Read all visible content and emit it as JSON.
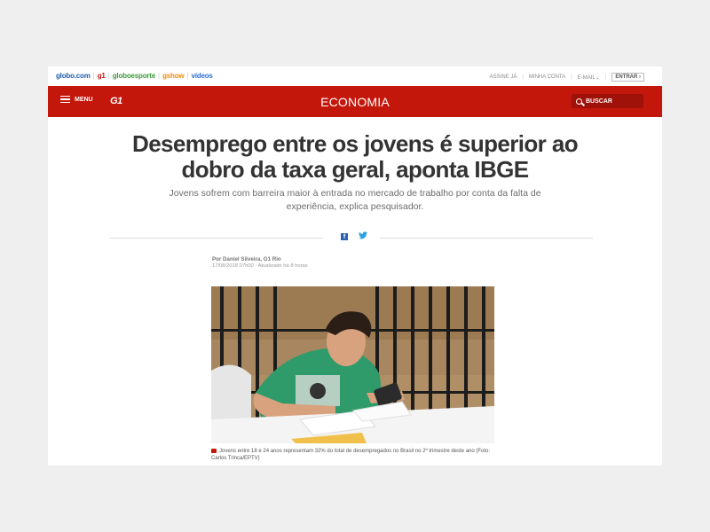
{
  "topbar": {
    "brands": [
      {
        "label": "globo.com",
        "color": "#1d5dad"
      },
      {
        "label": "g1",
        "color": "#c4170c"
      },
      {
        "label": "globoesporte",
        "color": "#3c9b3c"
      },
      {
        "label": "gshow",
        "color": "#f28c0f"
      },
      {
        "label": "vídeos",
        "color": "#2f6fd6"
      }
    ],
    "links": [
      "ASSINE JÁ",
      "MINHA CONTA",
      "E-MAIL"
    ],
    "email_chevron": "⌄",
    "enter_label": "ENTRAR",
    "enter_chevron": "›"
  },
  "header": {
    "menu_label": "MENU",
    "logo": "G1",
    "section": "ECONOMIA",
    "search_placeholder": "BUSCAR",
    "accent_color": "#c4170c"
  },
  "article": {
    "title": "Desemprego entre os jovens é superior ao dobro da taxa geral, aponta IBGE",
    "subtitle": "Jovens sofrem com barreira maior à entrada no mercado de trabalho por conta da falta de experiência, explica pesquisador.",
    "share": {
      "facebook_icon": "f",
      "twitter_icon": "🐦"
    },
    "author": "Por Daniel Silveira, G1 Rio",
    "date": "17/08/2018 07h00 · Atualizado há 8 horas",
    "photo_caption": "Jovens entre 18 e 24 anos representam 32% do total de desempregados no Brasil no 2º trimestre deste ano (Foto: Carlos Trinca/EPTV)"
  }
}
